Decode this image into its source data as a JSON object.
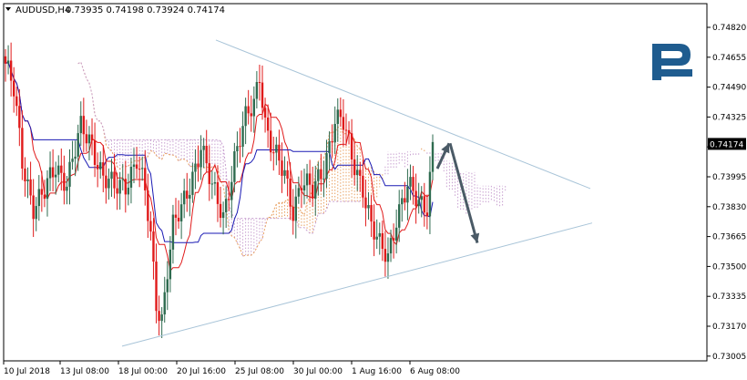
{
  "header": {
    "symbol": "AUDUSD,H4",
    "ohlc": "0.73935 0.74198 0.73924 0.74174"
  },
  "chart_data": {
    "type": "candlestick",
    "symbol": "AUDUSD",
    "timeframe": "H4",
    "open": 0.73935,
    "high": 0.74198,
    "low": 0.73924,
    "close": 0.74174,
    "ylim": [
      0.73,
      0.749
    ],
    "y_ticks": [
      "0.74820",
      "0.74655",
      "0.74490",
      "0.74325",
      "0.74160",
      "0.73995",
      "0.73830",
      "0.73665",
      "0.73500",
      "0.73335",
      "0.73170",
      "0.73005"
    ],
    "x_ticks": [
      "10 Jul 2018",
      "13 Jul 08:00",
      "18 Jul 00:00",
      "20 Jul 16:00",
      "25 Jul 08:00",
      "30 Jul 00:00",
      "1 Aug 16:00",
      "6 Aug 08:00"
    ],
    "current_price": "0.74174",
    "grid": false,
    "colors": {
      "bull": "#2e6b4f",
      "bear": "#e01a1a",
      "tenkan": "#e01a1a",
      "kijun": "#1a1ab4",
      "cloud_a": "#e8a060",
      "cloud_b": "#c8a0d0",
      "triangle": "#a8c4d8",
      "arrow": "#4a5a66",
      "price_tag": "#000000"
    }
  }
}
